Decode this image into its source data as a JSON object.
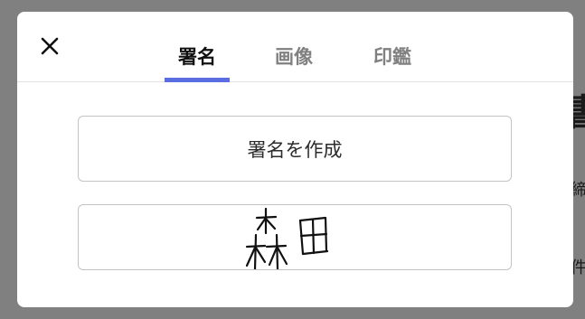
{
  "background": {
    "heading_fragment": "書",
    "line_fragment_1": "締",
    "line_fragment_2": "件"
  },
  "modal": {
    "tabs": [
      {
        "label": "署名",
        "active": true
      },
      {
        "label": "画像",
        "active": false
      },
      {
        "label": "印鑑",
        "active": false
      }
    ],
    "create_signature_label": "署名を作成",
    "saved_signature": {
      "handwritten_text": "森田",
      "icon": "handwritten-signature"
    },
    "close_icon": "close-icon"
  },
  "colors": {
    "overlay": "#808080",
    "tab_active_underline": "#5b6ee1",
    "tab_active_text": "#111111",
    "tab_inactive_text": "#808080"
  }
}
